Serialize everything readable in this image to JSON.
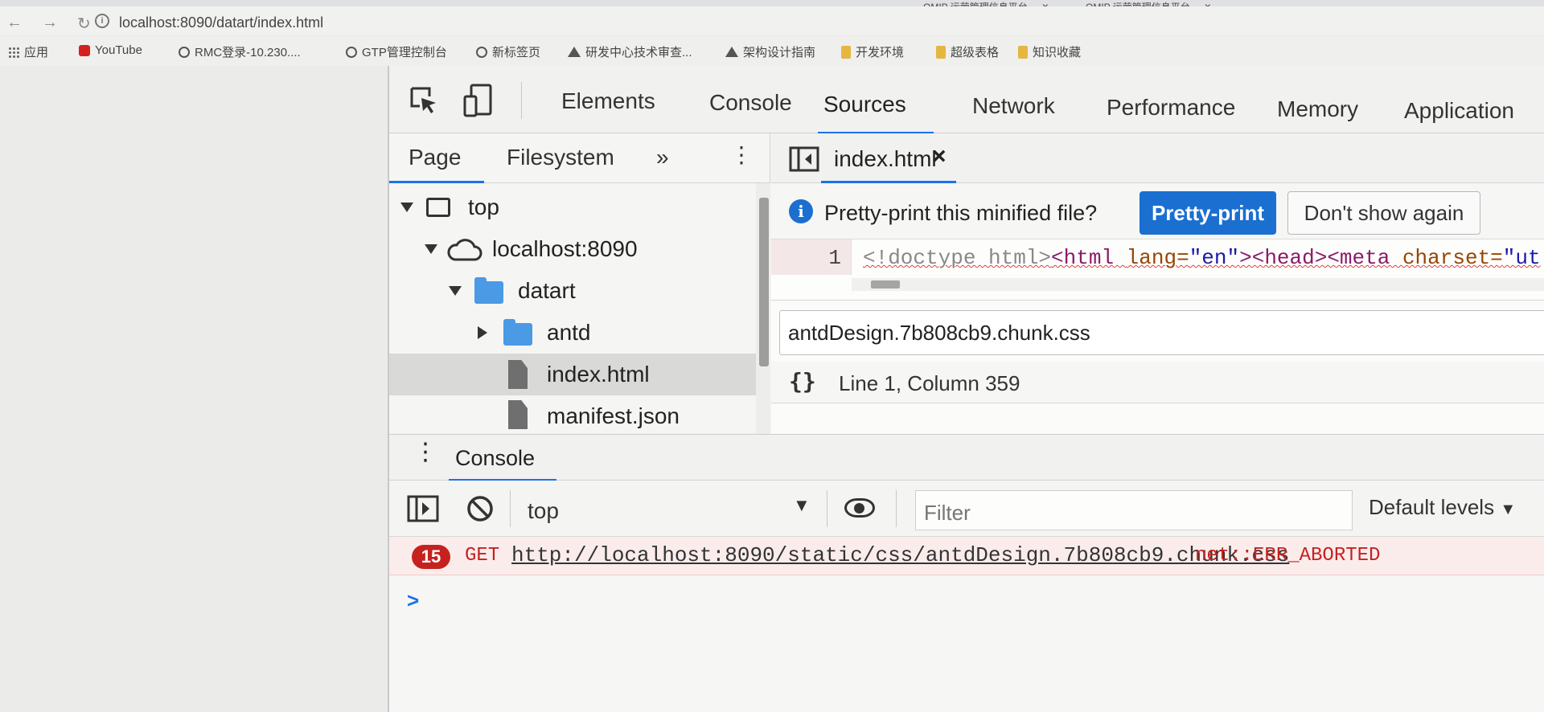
{
  "browser": {
    "tabs": [
      {
        "title": "OMIP 运营管理信息平台"
      },
      {
        "title": "OMIP 运营管理信息平台"
      }
    ],
    "address": "localhost:8090/datart/index.html",
    "bookmarks": [
      {
        "label": "应用",
        "icon": "apps-grid-icon"
      },
      {
        "label": "YouTube",
        "icon": "youtube-icon"
      },
      {
        "label": "RMC登录-10.230....",
        "icon": "globe-icon"
      },
      {
        "label": "GTP管理控制台",
        "icon": "globe-icon"
      },
      {
        "label": "新标签页",
        "icon": "globe-icon"
      },
      {
        "label": "研发中心技术审查...",
        "icon": "triangle-icon"
      },
      {
        "label": "架构设计指南",
        "icon": "triangle-icon"
      },
      {
        "label": "开发环境",
        "icon": "folder-icon"
      },
      {
        "label": "超级表格",
        "icon": "folder-icon"
      },
      {
        "label": "知识收藏",
        "icon": "folder-icon"
      }
    ]
  },
  "devtools": {
    "main_tabs": [
      "Elements",
      "Console",
      "Sources",
      "Network",
      "Performance",
      "Memory",
      "Application"
    ],
    "active_tab": "Sources",
    "navigator": {
      "tabs": [
        "Page",
        "Filesystem"
      ],
      "more": "»",
      "tree": [
        {
          "label": "top",
          "type": "frame"
        },
        {
          "label": "localhost:8090",
          "type": "origin"
        },
        {
          "label": "datart",
          "type": "folder"
        },
        {
          "label": "antd",
          "type": "folder"
        },
        {
          "label": "index.html",
          "type": "file",
          "selected": true
        },
        {
          "label": "manifest.json",
          "type": "file"
        }
      ]
    },
    "editor": {
      "file_tab": "index.html",
      "close": "×",
      "infobar": {
        "message": "Pretty-print this minified file?",
        "primary": "Pretty-print",
        "secondary": "Don't show again"
      },
      "line_number": "1",
      "code": {
        "doctype": "<!doctype html>",
        "t1": "<html ",
        "a1": "lang=",
        "v1": "\"en\"",
        "t2": "><head><meta ",
        "a2": "charset=",
        "v2": "\"ut"
      },
      "goto_value": "antdDesign.7b808cb9.chunk.css",
      "braces": "{}",
      "cursor": "Line 1, Column 359"
    },
    "console": {
      "drawer_tab": "Console",
      "context": "top",
      "filter_placeholder": "Filter",
      "levels": "Default levels",
      "error": {
        "count": "15",
        "method": "GET",
        "url": "http://localhost:8090/static/css/antdDesign.7b808cb9.chunk.css",
        "status": "net::ERR_ABORTED"
      },
      "prompt": ">"
    }
  }
}
